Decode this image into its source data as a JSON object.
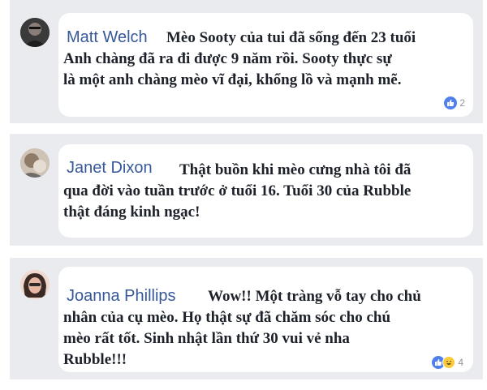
{
  "comments": [
    {
      "author": "Matt Welch",
      "lines": [
        "Mèo Sooty của tui đã sống đến 23 tuổi",
        "Anh chàng đã ra đi được 9 năm rồi. Sooty thực sự",
        "là một anh chàng mèo vĩ đại, khổng lồ và mạnh mẽ."
      ],
      "reactions": [
        "like-icon"
      ],
      "reaction_count": "2"
    },
    {
      "author": "Janet Dixon",
      "lines": [
        "Thật buồn khi mèo cưng nhà tôi đã",
        "qua đời vào tuần trước ở tuổi 16. Tuổi 30 của Rubble",
        "thật đáng kinh ngạc!"
      ]
    },
    {
      "author": "Joanna Phillips",
      "lines": [
        "Wow!! Một tràng vỗ tay cho chủ",
        "nhân của cụ mèo. Họ thật sự đã chăm sóc cho chú",
        "mèo rất tốt. Sinh nhật lần thứ 30 vui vẻ nha",
        "Rubble!!!"
      ],
      "reactions": [
        "like-icon",
        "haha-icon"
      ],
      "reaction_count": "4"
    }
  ],
  "colors": {
    "panel": "#e9ebee",
    "name": "#365899",
    "text": "#1d2129",
    "like": "#4f80eb",
    "haha": "#f8cc3d"
  }
}
